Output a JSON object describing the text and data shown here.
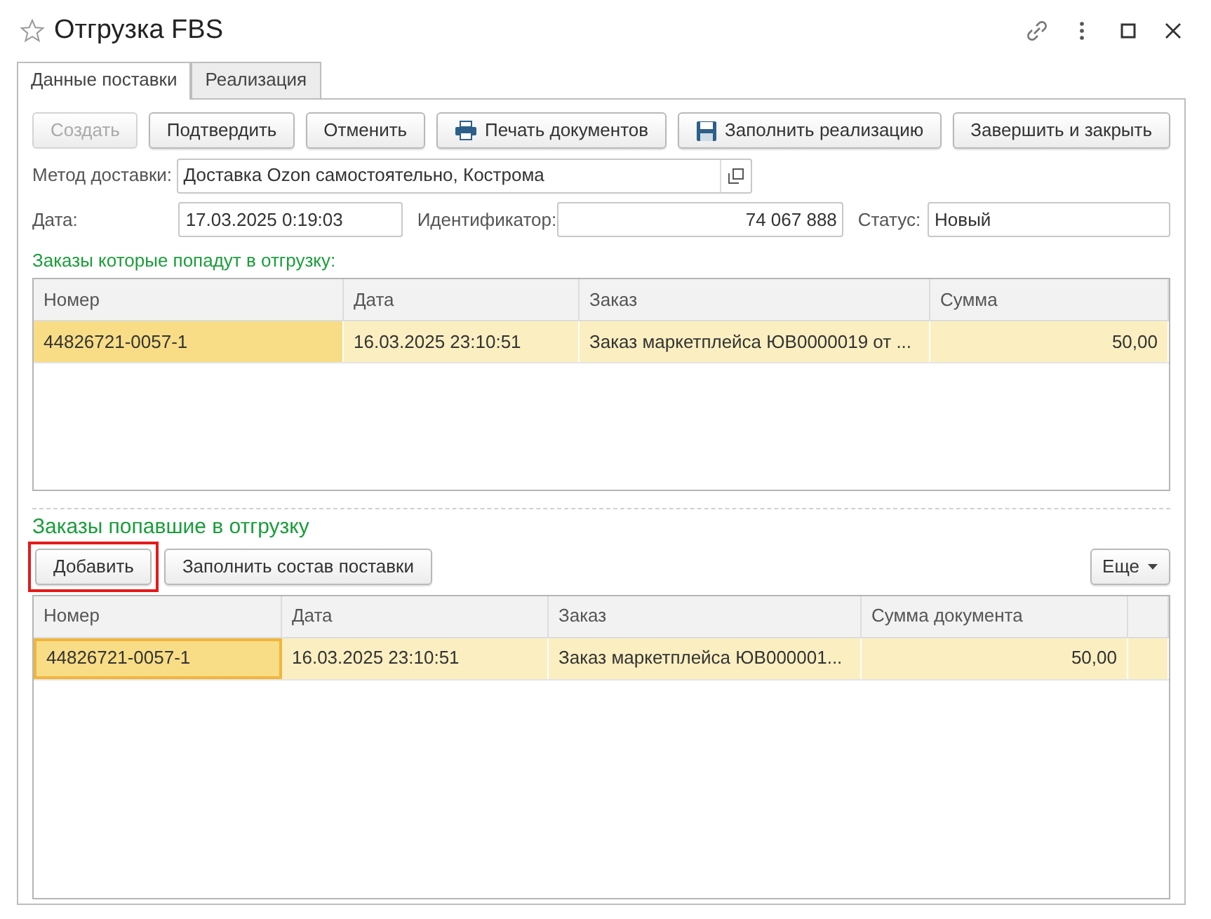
{
  "window": {
    "title": "Отгрузка FBS",
    "favorite": false
  },
  "tabs": [
    {
      "label": "Данные поставки",
      "selected": true
    },
    {
      "label": "Реализация",
      "selected": false
    }
  ],
  "toolbar": [
    {
      "label": "Создать",
      "kind": "plain",
      "disabled": true
    },
    {
      "label": "Подтвердить",
      "kind": "plain",
      "disabled": false
    },
    {
      "label": "Отменить",
      "kind": "plain",
      "disabled": false
    },
    {
      "label": "Печать документов",
      "kind": "print",
      "disabled": false
    },
    {
      "label": "Заполнить реализацию",
      "kind": "save",
      "disabled": false
    },
    {
      "label": "Завершить и закрыть",
      "kind": "plain",
      "disabled": false
    }
  ],
  "delivery_method": {
    "label": "Метод доставки:",
    "value": "Доставка Ozon самостоятельно, Кострома"
  },
  "date": {
    "label": "Дата:",
    "value": "17.03.2025  0:19:03"
  },
  "identifier": {
    "label": "Идентификатор:",
    "value": "74 067 888"
  },
  "status": {
    "label": "Статус:",
    "value": "Новый"
  },
  "tables": [
    {
      "title": "Заказы которые попадут в отгрузку:",
      "columns": [
        "Номер",
        "Дата",
        "Заказ",
        "Сумма"
      ],
      "rows": [
        {
          "selected": true,
          "cells": [
            {
              "text": "44826721-0057-1",
              "focused": true
            },
            {
              "text": "16.03.2025 23:10:51",
              "focused": false
            },
            {
              "text": "Заказ маркетплейса ЮВ0000019 от ...",
              "focused": false
            },
            {
              "text": "50,00",
              "focused": false
            }
          ]
        }
      ]
    },
    {
      "title": "Заказы попавшие в отгрузку",
      "buttons": [
        {
          "label": "Добавить",
          "highlighted": true
        },
        {
          "label": "Заполнить состав поставки",
          "highlighted": false
        }
      ],
      "more_button": "Еще",
      "columns": [
        "Номер",
        "Дата",
        "Заказ",
        "Сумма документа"
      ],
      "rows": [
        {
          "selected": true,
          "cells": [
            {
              "text": "44826721-0057-1",
              "focused": true
            },
            {
              "text": "16.03.2025 23:10:51",
              "focused": false
            },
            {
              "text": "Заказ маркетплейса ЮВ000001...",
              "focused": false
            },
            {
              "text": "50,00",
              "focused": false
            }
          ]
        }
      ]
    }
  ]
}
